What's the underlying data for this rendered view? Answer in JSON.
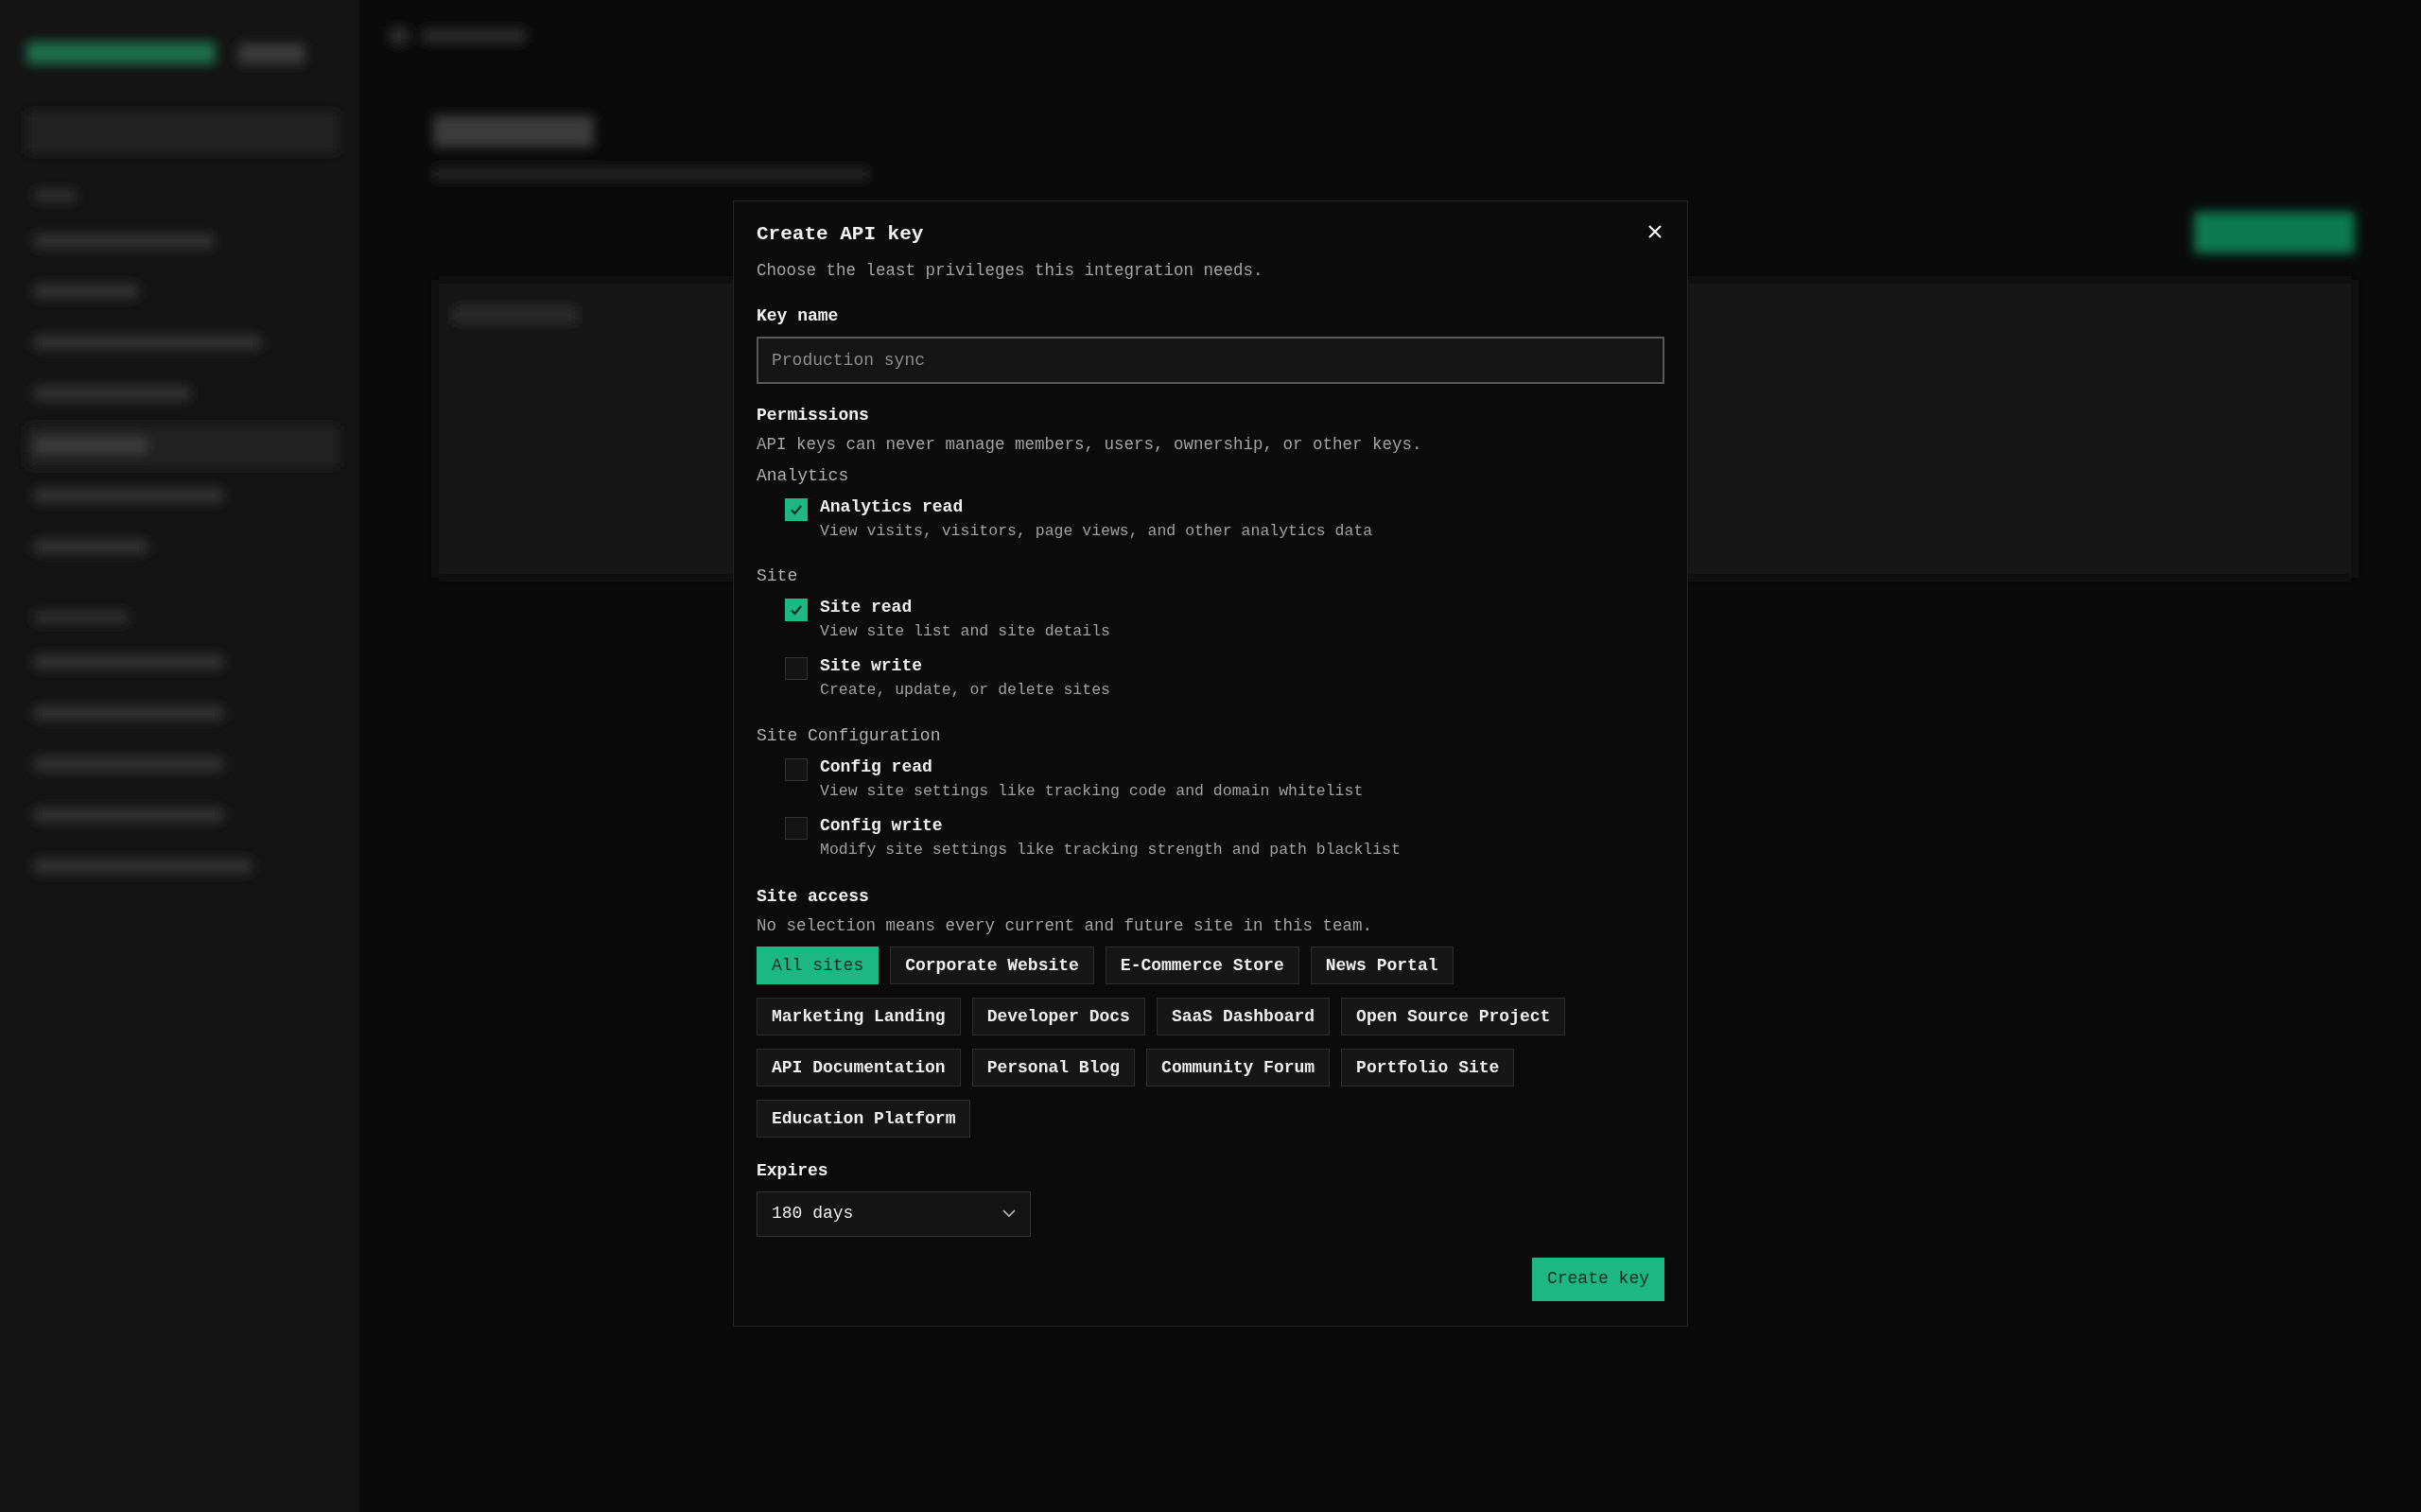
{
  "dialog": {
    "title": "Create API key",
    "subtitle": "Choose the least privileges this integration needs.",
    "key_name": {
      "label": "Key name",
      "placeholder": "Production sync"
    },
    "permissions": {
      "label": "Permissions",
      "note": "API keys can never manage members, users, ownership, or other keys.",
      "groups": [
        {
          "name": "Analytics",
          "items": [
            {
              "label": "Analytics read",
              "description": "View visits, visitors, page views, and other analytics data",
              "checked": true
            }
          ]
        },
        {
          "name": "Site",
          "items": [
            {
              "label": "Site read",
              "description": "View site list and site details",
              "checked": true
            },
            {
              "label": "Site write",
              "description": "Create, update, or delete sites",
              "checked": false
            }
          ]
        },
        {
          "name": "Site Configuration",
          "items": [
            {
              "label": "Config read",
              "description": "View site settings like tracking code and domain whitelist",
              "checked": false
            },
            {
              "label": "Config write",
              "description": "Modify site settings like tracking strength and path blacklist",
              "checked": false
            }
          ]
        }
      ]
    },
    "site_access": {
      "label": "Site access",
      "note": "No selection means every current and future site in this team.",
      "sites": [
        {
          "label": "All sites",
          "selected": true
        },
        {
          "label": "Corporate Website",
          "selected": false
        },
        {
          "label": "E-Commerce Store",
          "selected": false
        },
        {
          "label": "News Portal",
          "selected": false
        },
        {
          "label": "Marketing Landing",
          "selected": false
        },
        {
          "label": "Developer Docs",
          "selected": false
        },
        {
          "label": "SaaS Dashboard",
          "selected": false
        },
        {
          "label": "Open Source Project",
          "selected": false
        },
        {
          "label": "API Documentation",
          "selected": false
        },
        {
          "label": "Personal Blog",
          "selected": false
        },
        {
          "label": "Community Forum",
          "selected": false
        },
        {
          "label": "Portfolio Site",
          "selected": false
        },
        {
          "label": "Education Platform",
          "selected": false
        }
      ]
    },
    "expires": {
      "label": "Expires",
      "value": "180 days"
    },
    "submit": "Create key"
  }
}
